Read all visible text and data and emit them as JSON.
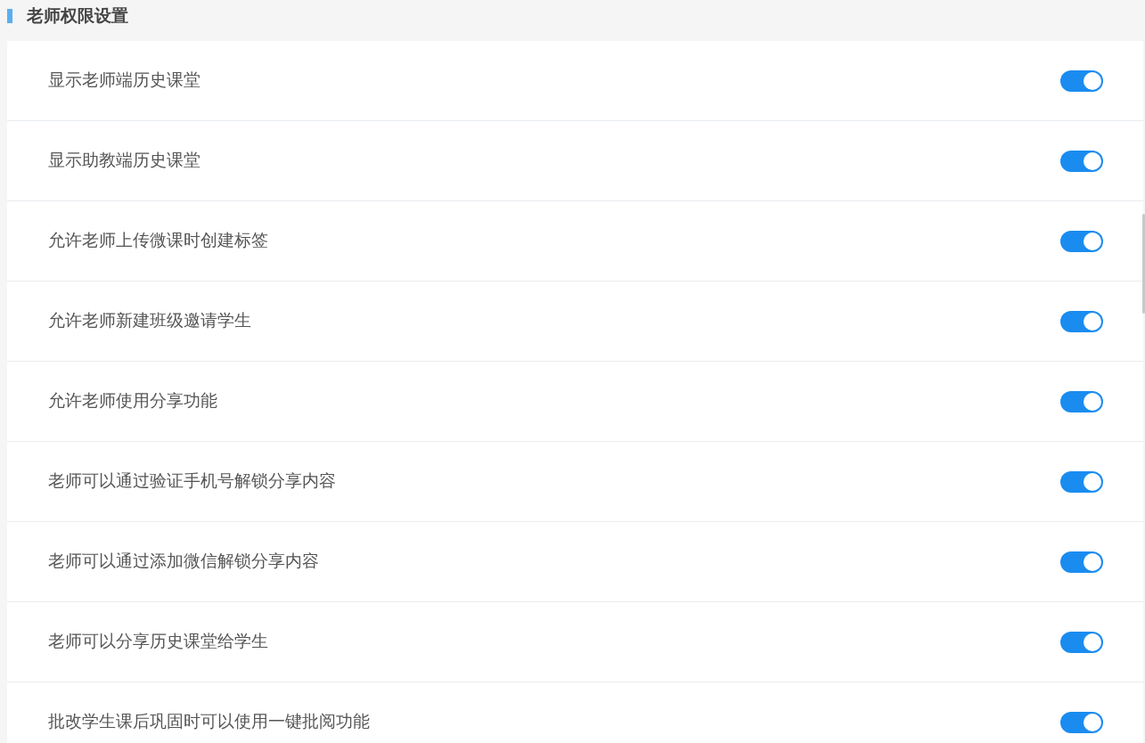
{
  "section": {
    "title": "老师权限设置"
  },
  "settings": [
    {
      "label": "显示老师端历史课堂",
      "on": true
    },
    {
      "label": "显示助教端历史课堂",
      "on": true
    },
    {
      "label": "允许老师上传微课时创建标签",
      "on": true
    },
    {
      "label": "允许老师新建班级邀请学生",
      "on": true
    },
    {
      "label": "允许老师使用分享功能",
      "on": true
    },
    {
      "label": "老师可以通过验证手机号解锁分享内容",
      "on": true
    },
    {
      "label": "老师可以通过添加微信解锁分享内容",
      "on": true
    },
    {
      "label": "老师可以分享历史课堂给学生",
      "on": true
    },
    {
      "label": "批改学生课后巩固时可以使用一键批阅功能",
      "on": true
    }
  ]
}
